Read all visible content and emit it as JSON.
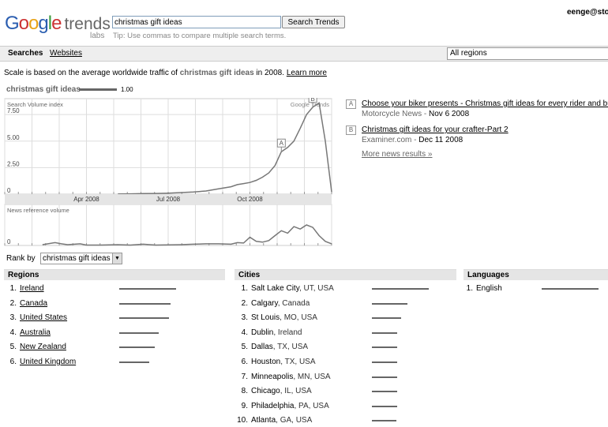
{
  "header": {
    "logo_letters": [
      "G",
      "o",
      "o",
      "g",
      "l",
      "e"
    ],
    "logo_trends": "trends",
    "logo_labs": "labs",
    "search_value": "christmas gift ideas",
    "search_button": "Search Trends",
    "tip": "Tip: Use commas to compare multiple search terms.",
    "user": "eenge@sto"
  },
  "nav": {
    "searches": "Searches",
    "websites": "Websites",
    "region": "All regions"
  },
  "scale": {
    "prefix": "Scale is based on the average worldwide traffic of ",
    "term": "christmas gift ideas",
    "suffix": " in 2008.",
    "learn_more": "Learn more"
  },
  "legend": {
    "term": "christmas gift ideas",
    "value": "1.00"
  },
  "colors": {
    "line": "#777777",
    "grid": "#dddddd",
    "bar": "#666666",
    "header_bg": "#e5e5e5"
  },
  "chart_data": [
    {
      "type": "line",
      "ylabel": "Search Volume index",
      "watermark": "Google Trends",
      "yticks": [
        0,
        2.5,
        5,
        7.5
      ],
      "ytick_labels": [
        "0",
        "2.50",
        "5.00",
        "7.50"
      ],
      "ylim": [
        0,
        9
      ],
      "xtick_labels": [
        "Apr 2008",
        "Jul 2008",
        "Oct 2008"
      ],
      "xtick_positions": [
        13,
        26,
        39
      ],
      "xlim": [
        0,
        52
      ],
      "series": [
        {
          "values": [
            [
              18,
              0.02
            ],
            [
              20,
              0.03
            ],
            [
              22,
              0.05
            ],
            [
              24,
              0.07
            ],
            [
              26,
              0.1
            ],
            [
              28,
              0.15
            ],
            [
              30,
              0.2
            ],
            [
              32,
              0.3
            ],
            [
              34,
              0.5
            ],
            [
              36,
              0.7
            ],
            [
              37,
              0.9
            ],
            [
              38,
              1.0
            ],
            [
              39,
              1.1
            ],
            [
              40,
              1.3
            ],
            [
              41,
              1.6
            ],
            [
              42,
              2.0
            ],
            [
              43,
              2.7
            ],
            [
              44,
              4.0
            ],
            [
              45,
              4.4
            ],
            [
              46,
              5.0
            ],
            [
              47,
              6.2
            ],
            [
              48,
              7.5
            ],
            [
              49,
              8.2
            ],
            [
              50,
              8.6
            ],
            [
              51,
              5.0
            ],
            [
              52,
              0.2
            ]
          ]
        }
      ],
      "markers": [
        {
          "label": "A",
          "x": 44,
          "y": 4.0
        },
        {
          "label": "B",
          "x": 49,
          "y": 8.2
        }
      ],
      "grid": true
    },
    {
      "type": "line",
      "ylabel": "News reference volume",
      "yticks": [
        0
      ],
      "ytick_labels": [
        "0"
      ],
      "ylim": [
        0,
        5
      ],
      "xlim": [
        0,
        52
      ],
      "series": [
        {
          "values": [
            [
              6,
              0.1
            ],
            [
              8,
              0.35
            ],
            [
              9,
              0.2
            ],
            [
              10,
              0.1
            ],
            [
              12,
              0.2
            ],
            [
              13,
              0.05
            ],
            [
              15,
              0.05
            ],
            [
              18,
              0.1
            ],
            [
              20,
              0.05
            ],
            [
              22,
              0.15
            ],
            [
              24,
              0.05
            ],
            [
              28,
              0.1
            ],
            [
              30,
              0.15
            ],
            [
              32,
              0.2
            ],
            [
              34,
              0.2
            ],
            [
              36,
              0.15
            ],
            [
              37,
              0.35
            ],
            [
              38,
              0.3
            ],
            [
              39,
              1.0
            ],
            [
              40,
              0.5
            ],
            [
              41,
              0.4
            ],
            [
              42,
              0.6
            ],
            [
              43,
              1.2
            ],
            [
              44,
              1.8
            ],
            [
              45,
              1.5
            ],
            [
              46,
              2.3
            ],
            [
              47,
              2.0
            ],
            [
              48,
              2.5
            ],
            [
              49,
              2.2
            ],
            [
              50,
              1.2
            ],
            [
              51,
              0.5
            ],
            [
              52,
              0.2
            ]
          ]
        }
      ],
      "grid": true
    }
  ],
  "news": [
    {
      "badge": "A",
      "title": "Choose your biker presents - Christmas gift ideas for every rider and budget",
      "source": "Motorcycle News - ",
      "date": "Nov 6 2008"
    },
    {
      "badge": "B",
      "title": "Christmas gift ideas for your crafter-Part 2",
      "source": "Examiner.com - ",
      "date": "Dec 11 2008"
    }
  ],
  "more_news": "More news results »",
  "rank": {
    "label": "Rank by",
    "value": "christmas gift ideas"
  },
  "regions": {
    "header": "Regions",
    "rows": [
      {
        "num": "1.",
        "name": "Ireland",
        "value": 1.0
      },
      {
        "num": "2.",
        "name": "Canada",
        "value": 0.9
      },
      {
        "num": "3.",
        "name": "United States",
        "value": 0.87
      },
      {
        "num": "4.",
        "name": "Australia",
        "value": 0.7
      },
      {
        "num": "5.",
        "name": "New Zealand",
        "value": 0.62
      },
      {
        "num": "6.",
        "name": "United Kingdom",
        "value": 0.53
      }
    ]
  },
  "cities": {
    "header": "Cities",
    "rows": [
      {
        "num": "1.",
        "city": "Salt Lake City",
        "sub": ", UT, USA",
        "value": 1.0
      },
      {
        "num": "2.",
        "city": "Calgary",
        "sub": ", Canada",
        "value": 0.63
      },
      {
        "num": "3.",
        "city": "St Louis",
        "sub": ", MO, USA",
        "value": 0.52
      },
      {
        "num": "4.",
        "city": "Dublin",
        "sub": ", Ireland",
        "value": 0.45
      },
      {
        "num": "5.",
        "city": "Dallas",
        "sub": ", TX, USA",
        "value": 0.45
      },
      {
        "num": "6.",
        "city": "Houston",
        "sub": ", TX, USA",
        "value": 0.45
      },
      {
        "num": "7.",
        "city": "Minneapolis",
        "sub": ", MN, USA",
        "value": 0.45
      },
      {
        "num": "8.",
        "city": "Chicago",
        "sub": ", IL, USA",
        "value": 0.45
      },
      {
        "num": "9.",
        "city": "Philadelphia",
        "sub": ", PA, USA",
        "value": 0.45
      },
      {
        "num": "10.",
        "city": "Atlanta",
        "sub": ", GA, USA",
        "value": 0.43
      }
    ]
  },
  "languages": {
    "header": "Languages",
    "rows": [
      {
        "num": "1.",
        "name": "English",
        "value": 1.0
      }
    ]
  }
}
